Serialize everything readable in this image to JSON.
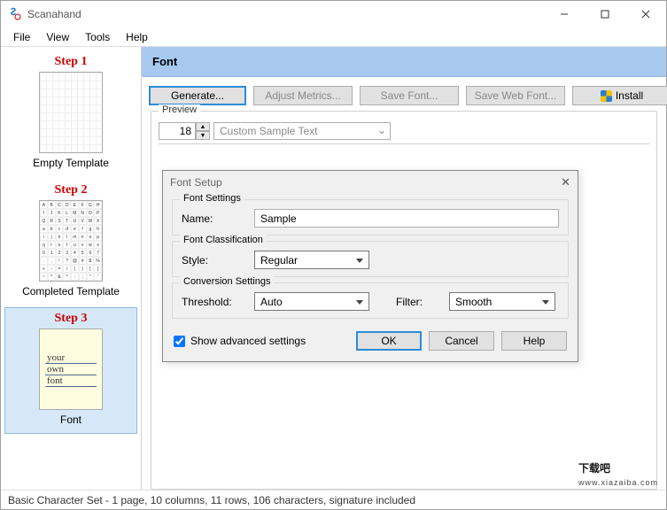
{
  "window": {
    "title": "Scanahand"
  },
  "menu": {
    "file": "File",
    "view": "View",
    "tools": "Tools",
    "help": "Help"
  },
  "sidebar": {
    "step1": {
      "title": "Step 1",
      "label": "Empty Template"
    },
    "step2": {
      "title": "Step 2",
      "label": "Completed Template"
    },
    "step3": {
      "title": "Step 3",
      "label": "Font",
      "line1": "your",
      "line2": "own",
      "line3": "font"
    }
  },
  "main": {
    "header": "Font",
    "toolbar": {
      "generate": "Generate...",
      "adjust": "Adjust Metrics...",
      "savefont": "Save Font...",
      "saveweb": "Save Web Font...",
      "install": "Install"
    },
    "preview": {
      "label": "Preview",
      "size": "18",
      "sample": "Custom Sample Text"
    }
  },
  "dialog": {
    "title": "Font Setup",
    "fontsettings": {
      "legend": "Font Settings",
      "name_label": "Name:",
      "name_value": "Sample"
    },
    "classification": {
      "legend": "Font Classification",
      "style_label": "Style:",
      "style_value": "Regular"
    },
    "conversion": {
      "legend": "Conversion Settings",
      "threshold_label": "Threshold:",
      "threshold_value": "Auto",
      "filter_label": "Filter:",
      "filter_value": "Smooth"
    },
    "show_advanced": "Show advanced settings",
    "ok": "OK",
    "cancel": "Cancel",
    "help": "Help"
  },
  "status": "Basic Character Set - 1 page, 10 columns, 11 rows, 106 characters, signature included",
  "watermark": {
    "big": "下载吧",
    "small": "www.xiazaiba.com"
  }
}
